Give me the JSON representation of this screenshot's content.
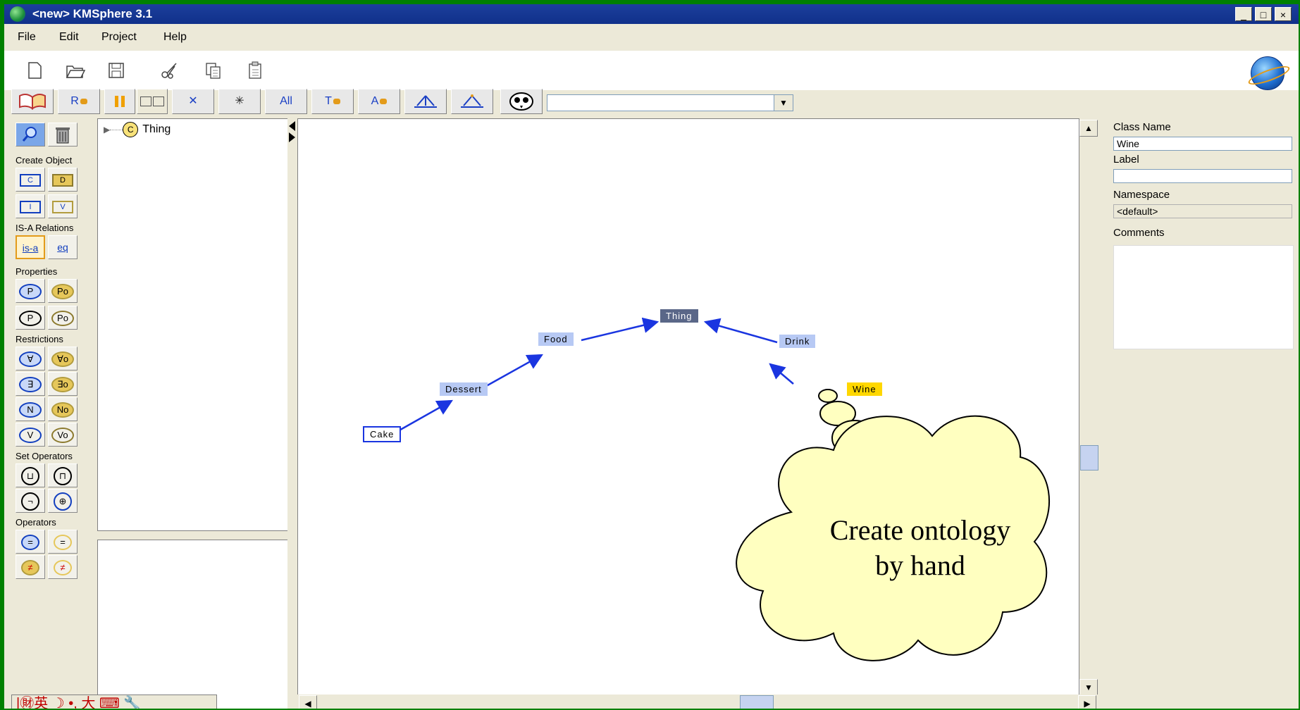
{
  "window": {
    "title": "<new>  KMSphere 3.1",
    "controls": [
      "_",
      "□",
      "×"
    ]
  },
  "menu": [
    "File",
    "Edit",
    "Project",
    "Help"
  ],
  "toolbar": {
    "text_buttons": [
      "R",
      "All",
      "T",
      "A"
    ],
    "search_value": ""
  },
  "palette": {
    "create_object_label": "Create Object",
    "create_object": [
      "C",
      "D",
      "I",
      "V"
    ],
    "isa_label": "IS-A Relations",
    "isa": [
      "is-a",
      "eq"
    ],
    "properties_label": "Properties",
    "properties": [
      "P",
      "Po",
      "P",
      "Po"
    ],
    "restrictions_label": "Restrictions",
    "restrictions": [
      "∀",
      "∀o",
      "∃",
      "∃o",
      "N",
      "No",
      "V",
      "Vo"
    ],
    "set_operators_label": "Set Operators",
    "set_operators": [
      "⊔",
      "⊓",
      "¬",
      "⊕"
    ],
    "operators_label": "Operators",
    "operators": [
      "=",
      "=",
      "≠",
      "≠"
    ]
  },
  "tree": {
    "root_badge": "C",
    "root_label": "Thing"
  },
  "graph": {
    "nodes": {
      "thing": "Thing",
      "food": "Food",
      "drink": "Drink",
      "dessert": "Dessert",
      "wine": "Wine",
      "cake": "Cake"
    },
    "edges": [
      {
        "from": "Cake",
        "to": "Dessert"
      },
      {
        "from": "Dessert",
        "to": "Food"
      },
      {
        "from": "Food",
        "to": "Thing"
      },
      {
        "from": "Wine",
        "to": "Drink"
      },
      {
        "from": "Drink",
        "to": "Thing"
      }
    ],
    "selected_node": "Wine",
    "colors": {
      "edge": "#1a35e0",
      "node_fill": "#b7c9f4",
      "root_fill": "#5a6788",
      "selected_fill": "#ffd700"
    }
  },
  "callout": {
    "line1": "Create ontology",
    "line2": "by hand"
  },
  "properties_panel": {
    "class_name_label": "Class Name",
    "class_name_value": "Wine",
    "label_label": "Label",
    "label_value": "",
    "namespace_label": "Namespace",
    "namespace_value": "<default>",
    "comments_label": "Comments"
  },
  "ime_bar": {
    "text": "|㊖英 ☽ •, 大 ⌨ 🔧"
  }
}
